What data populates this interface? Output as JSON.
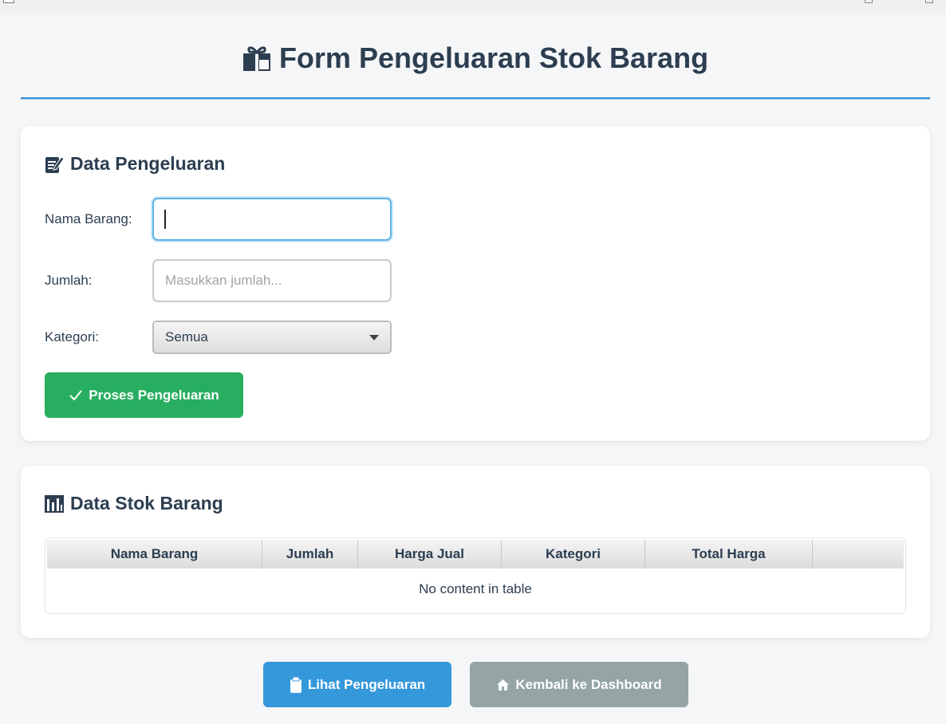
{
  "page": {
    "title": "Form Pengeluaran Stok Barang",
    "title_icon": "gift-box-icon"
  },
  "form_card": {
    "title": "Data Pengeluaran",
    "title_icon": "memo-pencil-icon",
    "fields": {
      "nama_barang": {
        "label": "Nama Barang:",
        "value": "",
        "placeholder": ""
      },
      "jumlah": {
        "label": "Jumlah:",
        "value": "",
        "placeholder": "Masukkan jumlah..."
      },
      "kategori": {
        "label": "Kategori:",
        "selected": "Semua"
      }
    },
    "submit_label": "Proses Pengeluaran",
    "submit_icon": "check-icon"
  },
  "table_card": {
    "title": "Data Stok Barang",
    "title_icon": "bar-chart-icon",
    "columns": [
      "Nama Barang",
      "Jumlah",
      "Harga Jual",
      "Kategori",
      "Total Harga",
      ""
    ],
    "rows": [],
    "empty_message": "No content in table"
  },
  "actions": {
    "view_label": "Lihat Pengeluaran",
    "view_icon": "clipboard-icon",
    "back_label": "Kembali ke Dashboard",
    "back_icon": "home-icon"
  },
  "colors": {
    "primary_green": "#27ae60",
    "primary_blue": "#3498db",
    "secondary_gray": "#95a5a6",
    "heading": "#2c3e50",
    "accent_rule": "#3d8fd1"
  }
}
